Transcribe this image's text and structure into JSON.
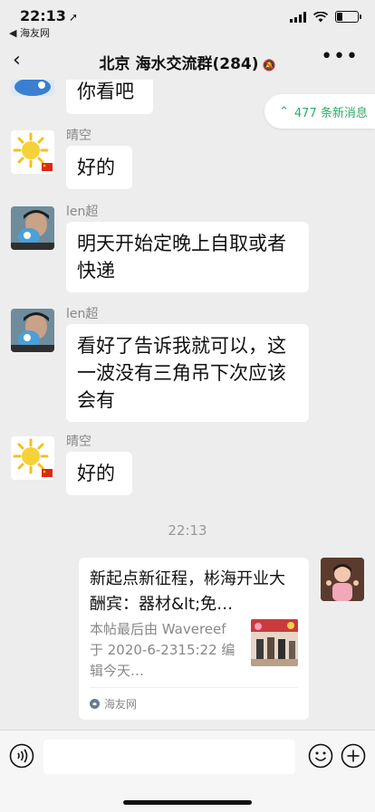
{
  "status_bar": {
    "time": "22:13",
    "location_arrow": "➚",
    "back_app": "◀ 海友网"
  },
  "nav": {
    "back_glyph": "‹",
    "title": "北京 海水交流群(284)",
    "mute_glyph": "🔕",
    "more_glyph": "•••"
  },
  "new_messages": {
    "icon": "⌃",
    "label": "477 条新消息"
  },
  "messages": [
    {
      "type": "text",
      "sender": "",
      "text": "你看吧"
    },
    {
      "type": "text",
      "sender": "晴空",
      "text": "好的"
    },
    {
      "type": "text",
      "sender": "len超",
      "text": "明天开始定晚上自取或者快递"
    },
    {
      "type": "text",
      "sender": "len超",
      "text": "看好了告诉我就可以，这一波没有三角吊下次应该会有"
    },
    {
      "type": "text",
      "sender": "晴空",
      "text": "好的"
    }
  ],
  "timestamp": "22:13",
  "link_card": {
    "title": "新起点新征程，彬海开业大酬宾：器材&lt;免…",
    "description": "本帖最后由 Wavereef于 2020-6-2315:22 编辑今天…",
    "source": "海友网"
  },
  "colors": {
    "accent_green": "#2bae67",
    "background": "#ededed",
    "bubble": "#ffffff"
  }
}
